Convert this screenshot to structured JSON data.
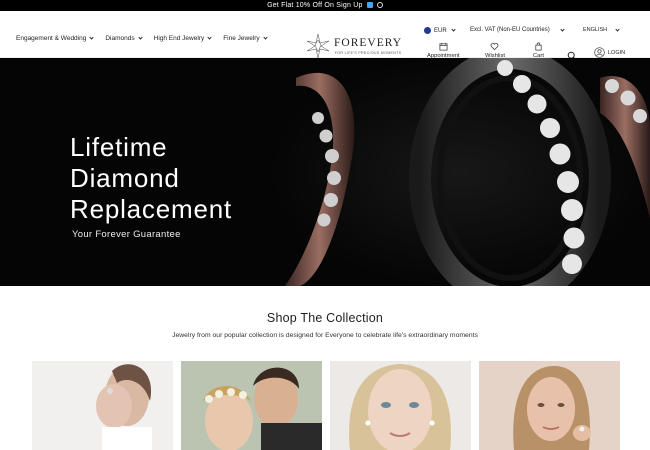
{
  "announcement": {
    "text": "Get Flat 10% Off On Sign Up"
  },
  "nav": {
    "items": [
      {
        "label": "Engagement & Wedding"
      },
      {
        "label": "Diamonds"
      },
      {
        "label": "High End Jewelry"
      },
      {
        "label": "Fine Jewelry"
      }
    ]
  },
  "brand": {
    "name": "FOREVERY",
    "tagline": "FOR LIFE'S PRECIOUS MOMENTS"
  },
  "utilities": {
    "currency": "EUR",
    "vat": "Excl. VAT (Non-EU Countries)",
    "language": "ENGLISH",
    "appointment": "Appointment",
    "wishlist": "Wishlist",
    "cart": "Cart",
    "login": "LOGIN"
  },
  "hero": {
    "title": "Lifetime\nDiamond\nReplacement",
    "subtitle": "Your Forever Guarantee"
  },
  "collection": {
    "title": "Shop The Collection",
    "description": "Jewelry from our popular collection is designed for Everyone to celebrate life's extraordinary moments"
  },
  "colors": {
    "topbar": "#000000",
    "hero_bg": "#050505",
    "text": "#222222",
    "flag": "#1f3a93"
  },
  "icons": [
    "chevron-down-icon",
    "calendar-icon",
    "heart-icon",
    "bag-icon",
    "search-icon",
    "user-icon",
    "eu-flag-icon"
  ]
}
